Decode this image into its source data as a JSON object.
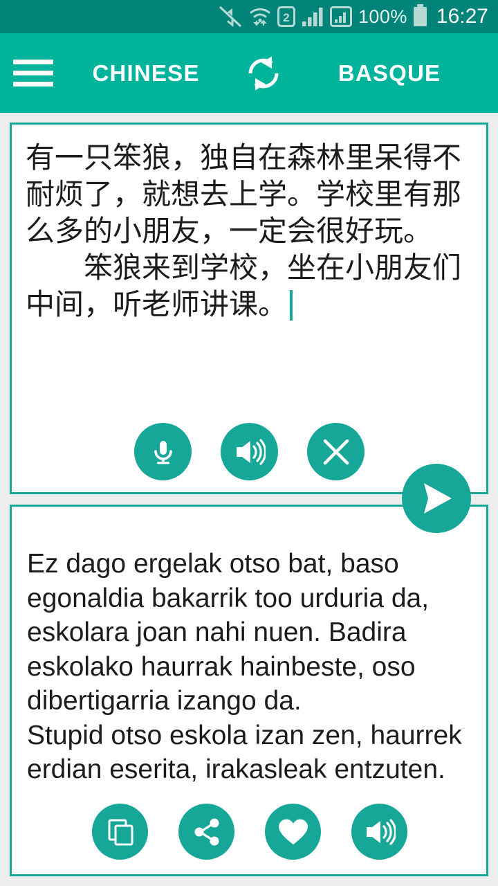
{
  "statusbar": {
    "time": "16:27",
    "battery_percent": "100%",
    "icons": [
      "mute-icon",
      "wifi-icon",
      "sim2-icon",
      "signal-bars-icon",
      "signal-bars-boxed-icon",
      "battery-icon"
    ]
  },
  "appbar": {
    "menu_icon": "hamburger-menu-icon",
    "source_language": "CHINESE",
    "swap_icon": "swap-languages-icon",
    "target_language": "BASQUE"
  },
  "source_card": {
    "text": "有一只笨狼，独自在森林里呆得不耐烦了，就想去上学。学校里有那么多的小朋友，一定会很好玩。\n　　笨狼来到学校，坐在小朋友们中间，听老师讲课。",
    "has_caret": true,
    "buttons": [
      {
        "name": "microphone-button",
        "icon": "microphone-icon"
      },
      {
        "name": "speak-source-button",
        "icon": "speaker-icon"
      },
      {
        "name": "clear-text-button",
        "icon": "close-x-icon"
      }
    ]
  },
  "send_button": {
    "name": "translate-send-button",
    "icon": "send-paper-plane-icon"
  },
  "target_card": {
    "text": "Ez dago ergelak otso bat, baso egonaldia bakarrik too urduria da, eskolara joan nahi nuen. Badira eskolako haurrak hainbeste, oso dibertigarria izango da.\nStupid otso eskola izan zen, haurrek erdian eserita, irakasleak entzuten.",
    "buttons": [
      {
        "name": "copy-button",
        "icon": "copy-icon"
      },
      {
        "name": "share-button",
        "icon": "share-icon"
      },
      {
        "name": "favorite-button",
        "icon": "heart-icon"
      },
      {
        "name": "speak-target-button",
        "icon": "speaker-icon"
      }
    ]
  },
  "colors": {
    "statusbar": "#00847a",
    "appbar": "#00b39b",
    "accent": "#16a798",
    "page_background": "#eceeed",
    "card_background": "#ffffff",
    "text": "#1c1c1c"
  }
}
